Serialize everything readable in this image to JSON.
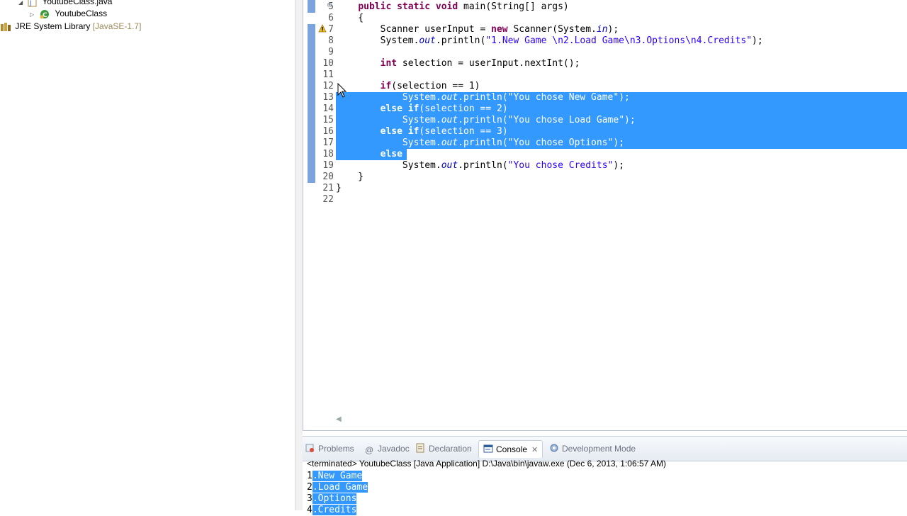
{
  "explorer": {
    "items": [
      {
        "label": "YoutubeClass.java",
        "extra": ""
      },
      {
        "label": "YoutubeClass",
        "extra": ""
      },
      {
        "label": "JRE System Library",
        "extra": "[JavaSE-1.7]"
      }
    ]
  },
  "editor": {
    "lines": [
      {
        "num": "5",
        "text": "    public static void main(String[] args)"
      },
      {
        "num": "6",
        "text": "    {"
      },
      {
        "num": "7",
        "text": "        Scanner userInput = new Scanner(System.in);"
      },
      {
        "num": "8",
        "text": "        System.out.println(\"1.New Game \\n2.Load Game\\n3.Options\\n4.Credits\");"
      },
      {
        "num": "9",
        "text": ""
      },
      {
        "num": "10",
        "text": "        int selection = userInput.nextInt();"
      },
      {
        "num": "11",
        "text": ""
      },
      {
        "num": "12",
        "text": "        if(selection == 1)"
      },
      {
        "num": "13",
        "text": "            System.out.println(\"You chose New Game\");"
      },
      {
        "num": "14",
        "text": "        else if(selection == 2)"
      },
      {
        "num": "15",
        "text": "            System.out.println(\"You chose Load Game\");"
      },
      {
        "num": "16",
        "text": "        else if(selection == 3)"
      },
      {
        "num": "17",
        "text": "            System.out.println(\"You chose Options\");"
      },
      {
        "num": "18",
        "text": "        else"
      },
      {
        "num": "19",
        "text": "            System.out.println(\"You chose Credits\");"
      },
      {
        "num": "20",
        "text": "    }"
      },
      {
        "num": "21",
        "text": "}"
      },
      {
        "num": "22",
        "text": ""
      }
    ]
  },
  "bottom": {
    "tabs": [
      {
        "label": "Problems",
        "icon": "problems-icon"
      },
      {
        "label": "Javadoc",
        "icon": "at-icon"
      },
      {
        "label": "Declaration",
        "icon": "declaration-icon"
      },
      {
        "label": "Console",
        "icon": "console-icon"
      },
      {
        "label": "Development Mode",
        "icon": "devmode-icon"
      }
    ],
    "close_glyph": "✕",
    "status": "<terminated> YoutubeClass [Java Application] D:\\Java\\bin\\javaw.exe (Dec 6, 2013, 1:06:57 AM)",
    "output": [
      {
        "num": "1",
        "text": ".New Game"
      },
      {
        "num": "2",
        "text": ".Load Game"
      },
      {
        "num": "3",
        "text": ".Options"
      },
      {
        "num": "4",
        "text": ".Credits"
      }
    ]
  },
  "colors": {
    "selection": "#3399ff",
    "keyword": "#7f0055",
    "string": "#2a00ff",
    "field": "#0000c0"
  }
}
